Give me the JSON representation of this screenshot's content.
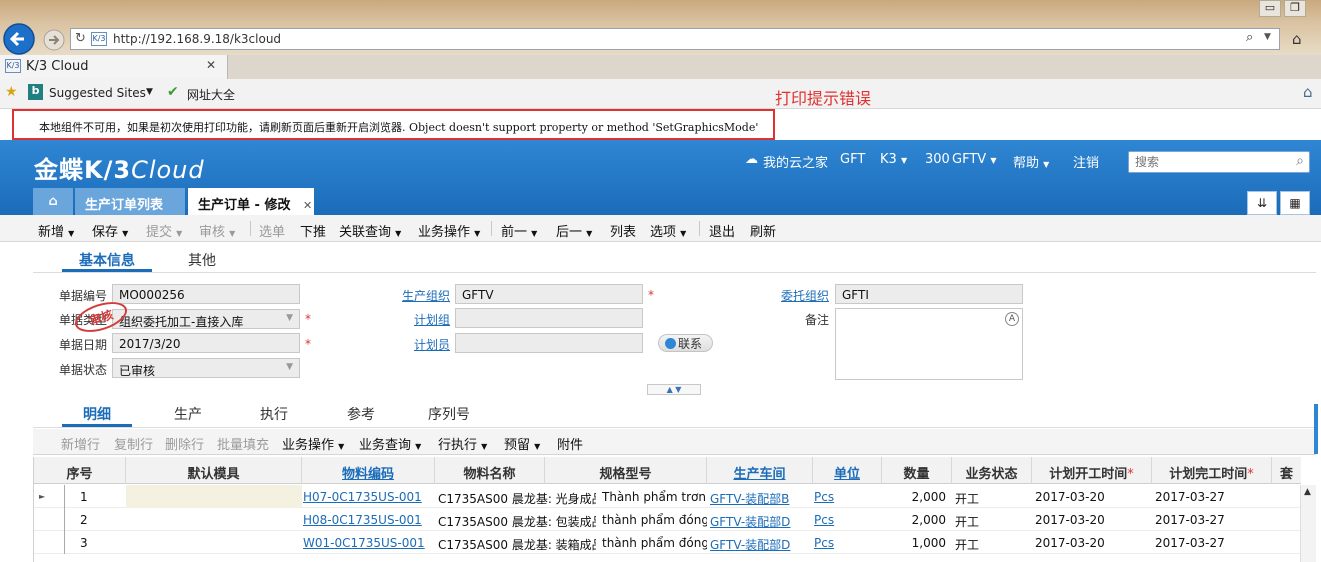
{
  "browser": {
    "url": "http://192.168.9.18/k3cloud",
    "tab_title": "K/3 Cloud",
    "favorites": [
      "Suggested Sites",
      "网址大全"
    ]
  },
  "notice": {
    "text": "本地组件不可用，如果是初次使用打印功能，请刷新页面后重新开启浏览器. Object doesn't support property or method 'SetGraphicsMode'",
    "annotation": "打印提示错误",
    "border_color": "#e03030"
  },
  "header": {
    "logo_main": "金蝶",
    "logo_k3": "K/3",
    "logo_cloud": "Cloud",
    "items": [
      "我的云之家",
      "GFT",
      "K3",
      "300",
      "GFTV",
      "帮助",
      "注销"
    ],
    "search_placeholder": "搜索",
    "accent": "#1b6cb9"
  },
  "app_tabs": {
    "home_icon": "home-icon",
    "list": "生产订单列表",
    "order": "生产订单 - 修改"
  },
  "toolbar": {
    "items": [
      "新增",
      "保存",
      "提交",
      "审核",
      "选单",
      "下推",
      "关联查询",
      "业务操作",
      "前一",
      "后一",
      "列表",
      "选项",
      "退出",
      "刷新"
    ]
  },
  "form_tabs": [
    "基本信息",
    "其他"
  ],
  "form": {
    "bill_no_label": "单据编号",
    "bill_no": "MO000256",
    "bill_type_label": "单据类型",
    "bill_type": "组织委托加工-直接入库",
    "stamp": "审核",
    "date_label": "单据日期",
    "date": "2017/3/20",
    "status_label": "单据状态",
    "status": "已审核",
    "prd_org_label": "生产组织",
    "prd_org": "GFTV",
    "plan_group_label": "计划组",
    "plan_group": "",
    "planner_label": "计划员",
    "planner": "",
    "entrust_org_label": "委托组织",
    "entrust_org": "GFTI",
    "note_label": "备注",
    "contact_button": "联系",
    "required_mark": "*"
  },
  "detail_tabs": [
    "明细",
    "生产",
    "执行",
    "参考",
    "序列号"
  ],
  "grid_toolbar": {
    "items": [
      "新增行",
      "复制行",
      "删除行",
      "批量填充",
      "业务操作",
      "业务查询",
      "行执行",
      "预留",
      "附件"
    ]
  },
  "grid": {
    "columns": [
      "序号",
      "默认模具",
      "物料编码",
      "物料名称",
      "规格型号",
      "生产车间",
      "单位",
      "数量",
      "业务状态",
      "计划开工时间",
      "计划完工时间",
      "套"
    ],
    "rows": [
      {
        "seq": "1",
        "mold": "",
        "code": "H07-0C1735US-001",
        "name": "C1735AS00 晨龙基: 光身成品",
        "spec": "Thành phẩm trơn",
        "workshop": "GFTV-装配部B",
        "unit": "Pcs",
        "qty": "2,000",
        "status": "开工",
        "start": "2017-03-20",
        "finish": "2017-03-27"
      },
      {
        "seq": "2",
        "mold": "",
        "code": "H08-0C1735US-001",
        "name": "C1735AS00 晨龙基: 包装成品",
        "spec": "thành phẩm đóng gói",
        "workshop": "GFTV-装配部D",
        "unit": "Pcs",
        "qty": "2,000",
        "status": "开工",
        "start": "2017-03-20",
        "finish": "2017-03-27"
      },
      {
        "seq": "3",
        "mold": "",
        "code": "W01-0C1735US-001",
        "name": "C1735AS00 晨龙基: 装箱成品",
        "spec": "thành phẩm đóng thùng",
        "workshop": "GFTV-装配部D",
        "unit": "Pcs",
        "qty": "1,000",
        "status": "开工",
        "start": "2017-03-20",
        "finish": "2017-03-27"
      }
    ]
  }
}
